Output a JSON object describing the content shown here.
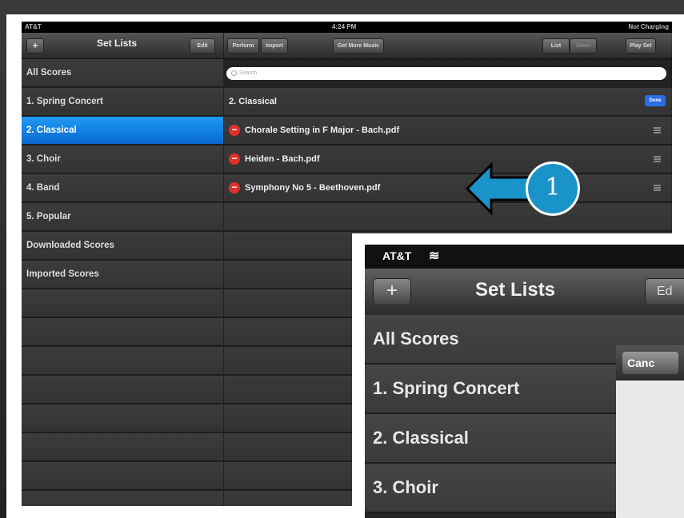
{
  "status": {
    "carrier": "AT&T",
    "time": "4:24 PM",
    "battery": "Not Charging"
  },
  "left_toolbar": {
    "add": "+",
    "title": "Set Lists",
    "edit": "Edit"
  },
  "right_toolbar": {
    "perform": "Perform",
    "import": "Import",
    "get_more": "Get More Music",
    "list": "List",
    "sheet": "Sheet",
    "play_set": "Play Set"
  },
  "sidebar": {
    "items": [
      {
        "label": "All Scores"
      },
      {
        "label": "1. Spring Concert"
      },
      {
        "label": "2. Classical"
      },
      {
        "label": "3. Choir"
      },
      {
        "label": "4. Band"
      },
      {
        "label": "5. Popular"
      },
      {
        "label": "Downloaded Scores"
      },
      {
        "label": "Imported Scores"
      }
    ],
    "selected": "2. Classical"
  },
  "search": {
    "placeholder": "Search"
  },
  "content": {
    "header": "2. Classical",
    "done": "Done",
    "files": [
      {
        "name": "Chorale Setting in F Major - Bach.pdf"
      },
      {
        "name": "Heiden - Bach.pdf"
      },
      {
        "name": "Symphony No 5 - Beethoven.pdf"
      }
    ]
  },
  "callout": {
    "number": "1"
  },
  "zoom": {
    "carrier": "AT&T",
    "add": "+",
    "title": "Set Lists",
    "edit": "Ed",
    "cancel": "Canc",
    "items": [
      {
        "label": "All Scores"
      },
      {
        "label": "1. Spring Concert"
      },
      {
        "label": "2. Classical"
      },
      {
        "label": "3. Choir"
      }
    ]
  },
  "colors": {
    "accent": "#1a93c9",
    "selected": "#1581e3",
    "delete": "#e0302a"
  }
}
